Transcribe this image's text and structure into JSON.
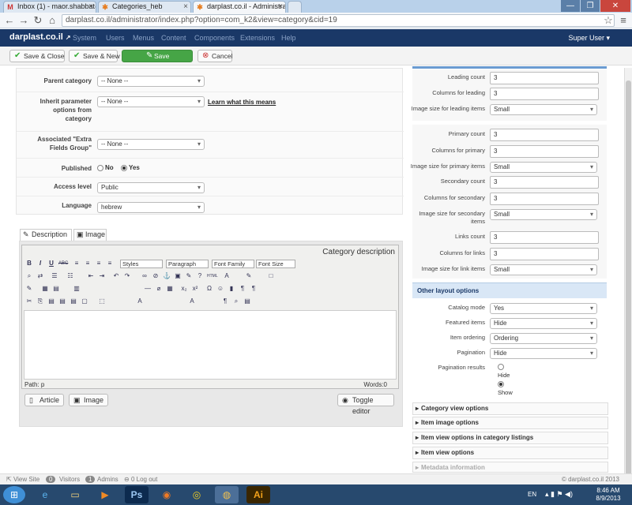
{
  "browser": {
    "tabs": [
      {
        "icon": "gmail-icon",
        "title": "Inbox (1) - maor.shabbat@"
      },
      {
        "icon": "joomla-icon",
        "title": "Categories_heb"
      },
      {
        "icon": "joomla-icon",
        "title": "darplast.co.il - Administra"
      }
    ],
    "url": "darplast.co.il/administrator/index.php?option=com_k2&view=category&cid=19"
  },
  "header": {
    "brand": "darplast.co.il",
    "menu": [
      "System",
      "Users",
      "Menus",
      "Content",
      "Components",
      "Extensions",
      "Help"
    ],
    "user": "Super User"
  },
  "toolbar": {
    "save_close": "Save & Close",
    "save_new": "Save & New",
    "save": "Save",
    "cancel": "Cancel"
  },
  "form": {
    "parent_category": {
      "label": "Parent category",
      "value": "-- None --"
    },
    "inherit": {
      "label": "Inherit parameter options from category",
      "value": "-- None --",
      "link": "Learn what this means"
    },
    "extra_fields": {
      "label": "Associated \"Extra Fields Group\"",
      "value": "-- None --"
    },
    "published": {
      "label": "Published",
      "no": "No",
      "yes": "Yes"
    },
    "access": {
      "label": "Access level",
      "value": "Public"
    },
    "language": {
      "label": "Language",
      "value": "hebrew"
    }
  },
  "editor": {
    "tab_description": "Description",
    "tab_image": "Image",
    "title": "Category description",
    "styles": "Styles",
    "paragraph": "Paragraph",
    "font_family": "Font Family",
    "font_size": "Font Size",
    "path": "Path: p",
    "words": "Words:0",
    "btn_article": "Article",
    "btn_image": "Image",
    "btn_toggle": "Toggle editor"
  },
  "right": {
    "leading_count": {
      "label": "Leading count",
      "value": "3"
    },
    "columns_leading": {
      "label": "Columns for leading",
      "value": "3"
    },
    "image_leading": {
      "label": "Image size for leading items",
      "value": "Small"
    },
    "primary_count": {
      "label": "Primary count",
      "value": "3"
    },
    "columns_primary": {
      "label": "Columns for primary",
      "value": "3"
    },
    "image_primary": {
      "label": "Image size for primary items",
      "value": "Small"
    },
    "secondary_count": {
      "label": "Secondary count",
      "value": "3"
    },
    "columns_secondary": {
      "label": "Columns for secondary",
      "value": "3"
    },
    "image_secondary": {
      "label": "Image size for secondary items",
      "value": "Small"
    },
    "links_count": {
      "label": "Links count",
      "value": "3"
    },
    "columns_links": {
      "label": "Columns for links",
      "value": "3"
    },
    "image_links": {
      "label": "Image size for link items",
      "value": "Small"
    },
    "other_layout": "Other layout options",
    "catalog_mode": {
      "label": "Catalog mode",
      "value": "Yes"
    },
    "featured_items": {
      "label": "Featured items",
      "value": "Hide"
    },
    "item_ordering": {
      "label": "Item ordering",
      "value": "Ordering"
    },
    "pagination": {
      "label": "Pagination",
      "value": "Hide"
    },
    "pagination_results": {
      "label": "Pagination results",
      "hide": "Hide",
      "show": "Show"
    },
    "sections": [
      "Category view options",
      "Item image options",
      "Item view options in category listings",
      "Item view options",
      "Metadata information"
    ]
  },
  "footer": {
    "view_site": "View Site",
    "visitors_count": "0",
    "visitors": "Visitors",
    "admins_count": "1",
    "admins": "Admins",
    "logout_count": "0",
    "logout": "Log out",
    "copyright": "© darplast.co.il 2013"
  },
  "taskbar": {
    "lang": "EN",
    "time": "8:46 AM",
    "date": "8/9/2013"
  }
}
